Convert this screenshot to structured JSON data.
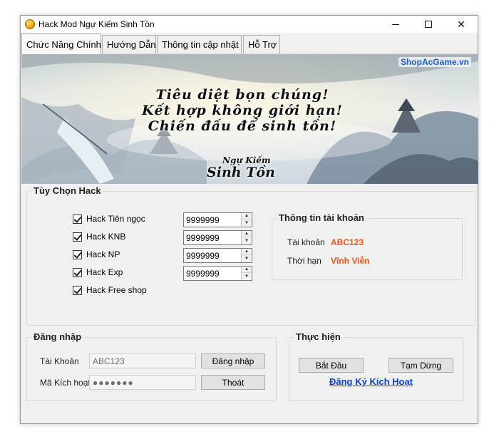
{
  "window": {
    "title": "Hack Mod Ngự Kiếm Sinh Tồn",
    "minimize_glyph": "",
    "close_glyph": "✕"
  },
  "tabs": [
    {
      "label": "Chức Năng Chính",
      "active": true
    },
    {
      "label": "Hướng Dẫn"
    },
    {
      "label": "Thông tin cập nhật"
    },
    {
      "label": "Hỗ Trợ"
    }
  ],
  "banner": {
    "shop_logo": "ShopAcGame.vn",
    "slogan_lines": [
      "Tiêu diệt bọn chúng!",
      "Kết hợp không giới hạn!",
      "Chiến đấu để sinh tồn!"
    ],
    "game_logo_line1": "Ngự Kiếm",
    "game_logo_line2": "Sinh Tồn"
  },
  "hack_options": {
    "legend": "Tùy Chọn Hack",
    "items": [
      {
        "label": "Hack Tiên ngọc",
        "checked": true,
        "value": "9999999"
      },
      {
        "label": "Hack KNB",
        "checked": true,
        "value": "9999999"
      },
      {
        "label": "Hack NP",
        "checked": true,
        "value": "9999999"
      },
      {
        "label": "Hack Exp",
        "checked": true,
        "value": "9999999"
      },
      {
        "label": "Hack Free shop",
        "checked": true
      }
    ]
  },
  "account_info": {
    "legend": "Thông tin tài khoản",
    "account_label": "Tài khoản",
    "account_value": "ABC123",
    "duration_label": "Thời hạn",
    "duration_value": "Vĩnh Viễn"
  },
  "login": {
    "legend": "Đăng nhập",
    "account_label": "Tài Khoản",
    "account_value": "ABC123",
    "code_label": "Mã Kích hoạt",
    "code_value": "●●●●●●●",
    "login_button": "Đăng nhập",
    "exit_button": "Thoát"
  },
  "execute": {
    "legend": "Thực hiện",
    "start_button": "Bắt Đầu",
    "pause_button": "Tạm Dừng",
    "register_link": "Đăng Ký Kích Hoạt"
  },
  "colors": {
    "accent_value": "#f0541e",
    "link": "#0b3fd9"
  }
}
